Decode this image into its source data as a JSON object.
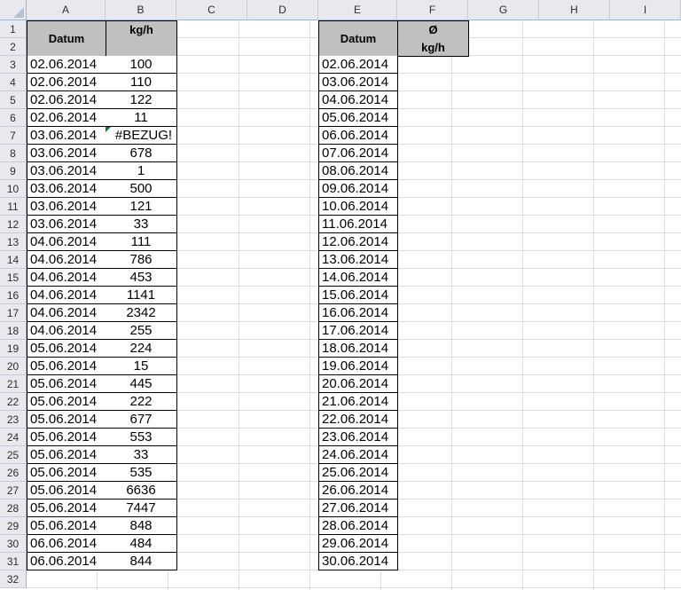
{
  "columns": [
    "A",
    "B",
    "C",
    "D",
    "E",
    "F",
    "G",
    "H",
    "I"
  ],
  "rows": [
    "1",
    "2",
    "3",
    "4",
    "5",
    "6",
    "7",
    "8",
    "9",
    "10",
    "11",
    "12",
    "13",
    "14",
    "15",
    "16",
    "17",
    "18",
    "19",
    "20",
    "21",
    "22",
    "23",
    "24",
    "25",
    "26",
    "27",
    "28",
    "29",
    "30",
    "31",
    "32"
  ],
  "left_table": {
    "header_date": "Datum",
    "header_value": "kg/h",
    "dates": [
      "02.06.2014",
      "02.06.2014",
      "02.06.2014",
      "02.06.2014",
      "03.06.2014",
      "03.06.2014",
      "03.06.2014",
      "03.06.2014",
      "03.06.2014",
      "03.06.2014",
      "04.06.2014",
      "04.06.2014",
      "04.06.2014",
      "04.06.2014",
      "04.06.2014",
      "04.06.2014",
      "05.06.2014",
      "05.06.2014",
      "05.06.2014",
      "05.06.2014",
      "05.06.2014",
      "05.06.2014",
      "05.06.2014",
      "05.06.2014",
      "05.06.2014",
      "05.06.2014",
      "05.06.2014",
      "06.06.2014",
      "06.06.2014"
    ],
    "values": [
      "100",
      "110",
      "122",
      "11",
      "#BEZUG!",
      "678",
      "1",
      "500",
      "121",
      "33",
      "111",
      "786",
      "453",
      "1141",
      "2342",
      "255",
      "224",
      "15",
      "445",
      "222",
      "677",
      "553",
      "33",
      "535",
      "6636",
      "7447",
      "848",
      "484",
      "844"
    ]
  },
  "right_table": {
    "header_date": "Datum",
    "header_avg_symbol": "Ø",
    "header_avg_unit": "kg/h",
    "dates": [
      "02.06.2014",
      "03.06.2014",
      "04.06.2014",
      "05.06.2014",
      "06.06.2014",
      "07.06.2014",
      "08.06.2014",
      "09.06.2014",
      "10.06.2014",
      "11.06.2014",
      "12.06.2014",
      "13.06.2014",
      "14.06.2014",
      "15.06.2014",
      "16.06.2014",
      "17.06.2014",
      "18.06.2014",
      "19.06.2014",
      "20.06.2014",
      "21.06.2014",
      "22.06.2014",
      "23.06.2014",
      "24.06.2014",
      "25.06.2014",
      "26.06.2014",
      "27.06.2014",
      "28.06.2014",
      "29.06.2014",
      "30.06.2014"
    ]
  }
}
